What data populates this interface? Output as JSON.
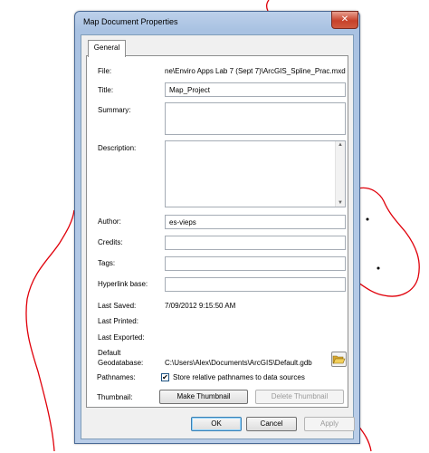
{
  "window": {
    "title": "Map Document Properties",
    "close_glyph": "✕"
  },
  "tabs": [
    {
      "label": "General"
    }
  ],
  "fields": {
    "file": {
      "label": "File:",
      "value": "ne\\Enviro Apps Lab 7 (Sept 7)\\ArcGIS_Spline_Prac.mxd"
    },
    "title": {
      "label": "Title:",
      "value": "Map_Project"
    },
    "summary": {
      "label": "Summary:",
      "value": ""
    },
    "description": {
      "label": "Description:",
      "value": ""
    },
    "author": {
      "label": "Author:",
      "value": "es-vieps"
    },
    "credits": {
      "label": "Credits:",
      "value": ""
    },
    "tags": {
      "label": "Tags:",
      "value": ""
    },
    "hyperlink_base": {
      "label": "Hyperlink base:",
      "value": ""
    },
    "last_saved": {
      "label": "Last Saved:",
      "value": "7/09/2012 9:15:50 AM"
    },
    "last_printed": {
      "label": "Last Printed:",
      "value": ""
    },
    "last_exported": {
      "label": "Last Exported:",
      "value": ""
    },
    "default_gdb": {
      "label_line1": "Default",
      "label_line2": "Geodatabase:",
      "value": "C:\\Users\\Alex\\Documents\\ArcGIS\\Default.gdb"
    },
    "pathnames": {
      "label": "Pathnames:",
      "checkbox_label": "Store relative pathnames to data sources",
      "checked": true,
      "check_glyph": "✔"
    },
    "thumbnail": {
      "label": "Thumbnail:"
    }
  },
  "buttons": {
    "make_thumbnail": "Make Thumbnail",
    "delete_thumbnail": "Delete Thumbnail",
    "ok": "OK",
    "cancel": "Cancel",
    "apply": "Apply"
  },
  "icons": {
    "folder": "folder-open-icon",
    "scroll_up": "▲",
    "scroll_down": "▼"
  },
  "colors": {
    "annotation_line": "#e0000a",
    "titlebar": "#b9cde8",
    "accent": "#3c7fb1"
  }
}
